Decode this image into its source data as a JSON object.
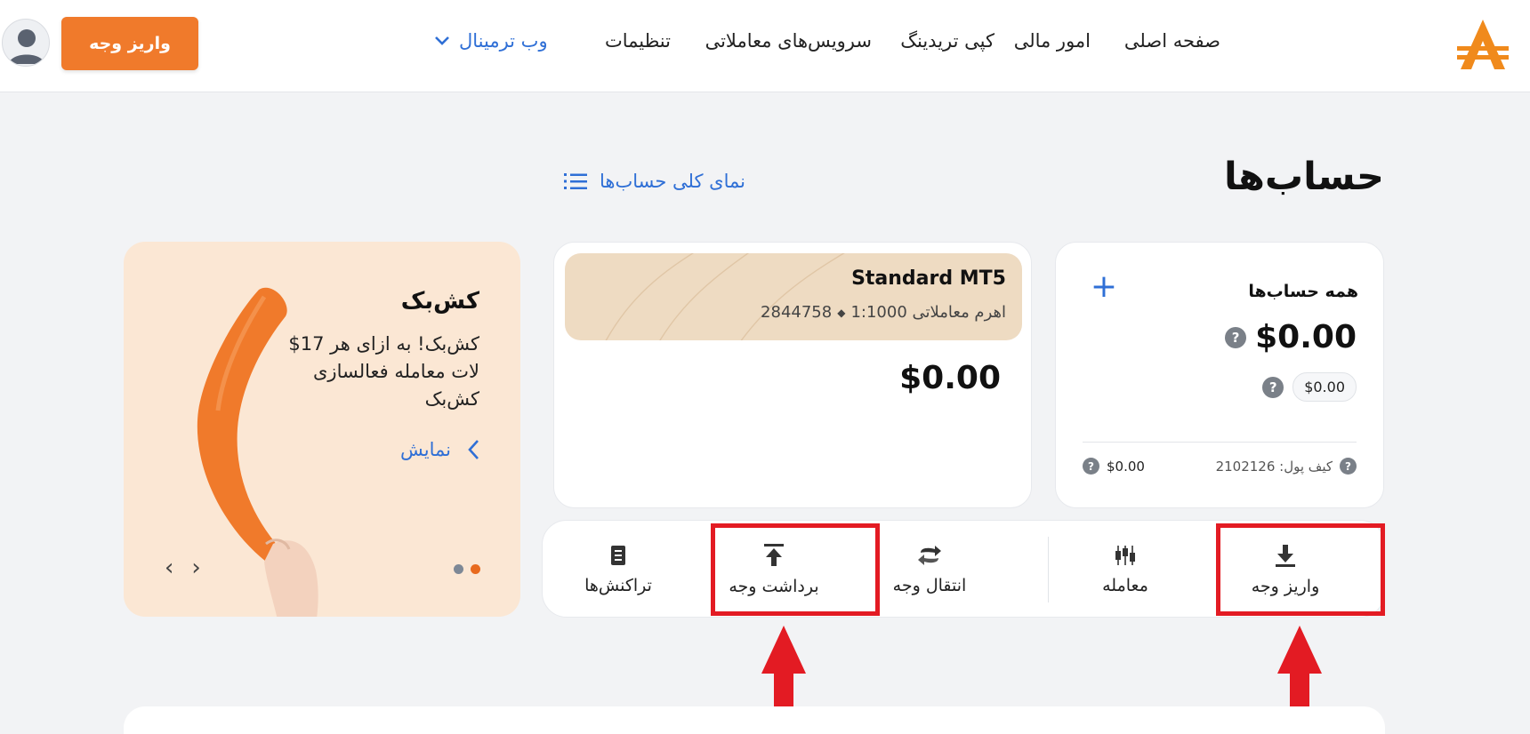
{
  "header": {
    "nav": {
      "home": "صفحه اصلی",
      "finance": "امور مالی",
      "copy_trading": "کپی تریدینگ",
      "trading_services": "سرویس‌های معاملاتی",
      "settings": "تنظیمات",
      "web_terminal": "وب ترمینال"
    },
    "deposit_button": "واریز وجه",
    "logo_icon": "brand-logo",
    "avatar_icon": "user-avatar-icon"
  },
  "page": {
    "title": "حساب‌ها",
    "overview_link": "نمای کلی حساب‌ها"
  },
  "all_accounts": {
    "title": "همه حساب‌ها",
    "total": "$0.00",
    "sub_amount": "$0.00",
    "wallet_label": "کیف پول: 2102126",
    "wallet_amount": "$0.00"
  },
  "standard_account": {
    "name": "Standard MT5",
    "number": "2844758",
    "separator": "◆",
    "leverage": "اهرم معاملاتی 1:1000",
    "balance": "$0.00"
  },
  "promo": {
    "title": "کش‌بک",
    "text": "$17 کش‌بک! به ازای هر لات معامله فعالسازی کش‌بک",
    "link": "نمایش",
    "active_slide": 1,
    "slides": 2
  },
  "actions": {
    "deposit": "واریز وجه",
    "trade": "معامله",
    "transfer": "انتقال وجه",
    "withdraw": "برداشت وجه",
    "transactions": "تراکنش‌ها"
  },
  "colors": {
    "brand_orange": "#f07a2b",
    "link_blue": "#2f6fd6",
    "highlight_red": "#e31b23",
    "promo_bg": "#fbe7d4",
    "account_banner": "#eedbc2"
  }
}
